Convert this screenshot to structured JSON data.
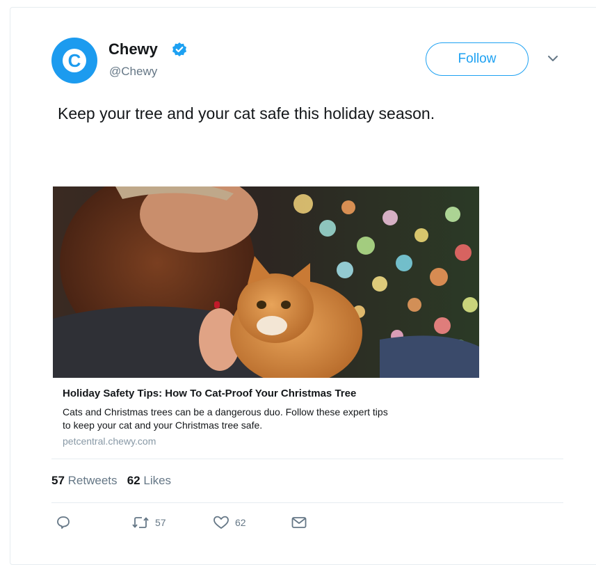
{
  "tweet": {
    "display_name": "Chewy",
    "handle": "@Chewy",
    "avatar_letter": "C",
    "verified": true,
    "follow_label": "Follow",
    "text": "Keep your tree and your cat safe this holiday season."
  },
  "link_card": {
    "image_alt": "Woman with an orange tabby cat in front of blurred Christmas lights",
    "title": "Holiday Safety Tips: How To Cat-Proof Your Christmas Tree",
    "description_line1": "Cats and Christmas trees can be a dangerous duo. Follow these expert tips",
    "description_line2": "to keep your cat and your Christmas tree safe.",
    "url": "petcentral.chewy.com"
  },
  "stats": {
    "retweets_count": "57",
    "retweets_label": "Retweets",
    "likes_count": "62",
    "likes_label": "Likes"
  },
  "actions": {
    "retweet_count": "57",
    "like_count": "62",
    "icons": [
      "reply-icon",
      "retweet-icon",
      "like-icon",
      "message-icon"
    ]
  },
  "colors": {
    "brand_blue": "#1da1f2",
    "text": "#14171a",
    "muted": "#657786"
  }
}
